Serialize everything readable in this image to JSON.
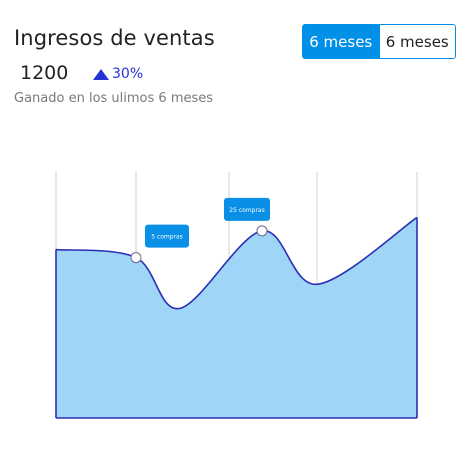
{
  "header": {
    "title": "Ingresos de ventas",
    "value": "1200",
    "delta": "30%",
    "delta_icon": "triangle-up-icon",
    "subtitle": "Ganado en los ulimos 6 meses"
  },
  "toggle": {
    "options": [
      "6 meses",
      "6 meses"
    ],
    "selected_index": 0
  },
  "colors": {
    "accent": "#0090e8",
    "delta": "#2433d6",
    "area_fill": "#9fd6f7",
    "line": "#2a2fb5",
    "grid": "#cfcfcf",
    "tooltip": "#0a8fe6"
  },
  "chart_data": {
    "type": "area",
    "categories": [
      "",
      "",
      "",
      "",
      "",
      ""
    ],
    "values": [
      315,
      300,
      205,
      350,
      250,
      375
    ],
    "ylim": [
      0,
      460
    ],
    "grid": "vertical",
    "annotations": [
      {
        "index": 1,
        "text": "5 compras"
      },
      {
        "index": 3,
        "text": "25 compras"
      }
    ]
  }
}
